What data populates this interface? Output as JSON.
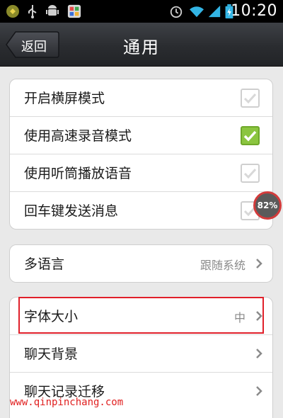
{
  "status_bar": {
    "time": "10:20",
    "icons": [
      "android-debug-icon",
      "usb-icon",
      "android-icon",
      "app-notification-icon",
      "alarm-icon",
      "wifi-icon",
      "signal-icon",
      "battery-icon"
    ]
  },
  "header": {
    "back_label": "返回",
    "title": "通用"
  },
  "toggles": [
    {
      "label": "开启横屏模式",
      "checked": false
    },
    {
      "label": "使用高速录音模式",
      "checked": true
    },
    {
      "label": "使用听筒播放语音",
      "checked": false
    },
    {
      "label": "回车键发送消息",
      "checked": false
    }
  ],
  "language": {
    "label": "多语言",
    "value": "跟随系统"
  },
  "settings_list": [
    {
      "label": "字体大小",
      "value": "中"
    },
    {
      "label": "聊天背景",
      "value": ""
    },
    {
      "label": "聊天记录迁移",
      "value": ""
    }
  ],
  "overlay_badge": "82%",
  "watermark": "www.qinpinchang.com",
  "colors": {
    "accent_check": "#8bc53f",
    "highlight": "#e0202a"
  }
}
